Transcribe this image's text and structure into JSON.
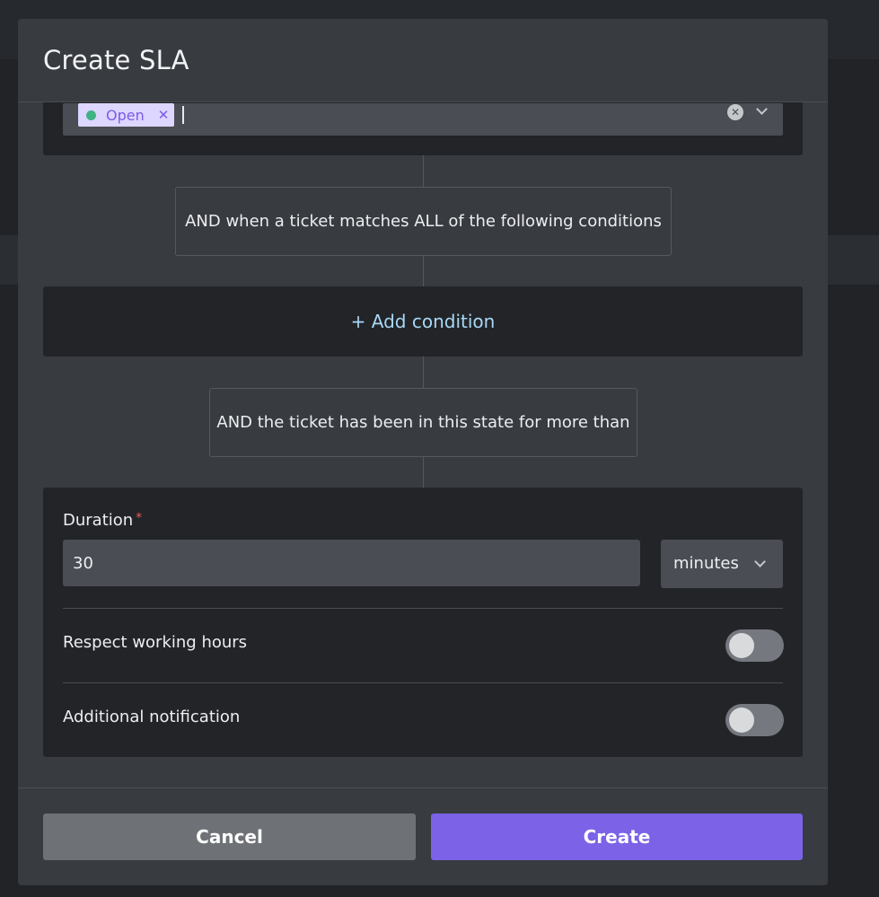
{
  "modal": {
    "title": "Create SLA"
  },
  "status_select": {
    "selected_chip": "Open",
    "chip_status_color": "#3fb383"
  },
  "conditions": {
    "match_text": "AND when a ticket matches ALL of the following conditions",
    "add_condition_label": "+ Add condition",
    "duration_text": "AND the ticket has been in this state for more than"
  },
  "duration": {
    "label": "Duration",
    "required_mark": "*",
    "value": "30",
    "unit": "minutes"
  },
  "options": {
    "respect_working_hours_label": "Respect working hours",
    "respect_working_hours_on": false,
    "additional_notification_label": "Additional notification",
    "additional_notification_on": false
  },
  "footer": {
    "cancel_label": "Cancel",
    "create_label": "Create"
  },
  "colors": {
    "accent": "#7b62e6",
    "add_condition": "#a8d8f5",
    "required": "#e45a5a"
  }
}
